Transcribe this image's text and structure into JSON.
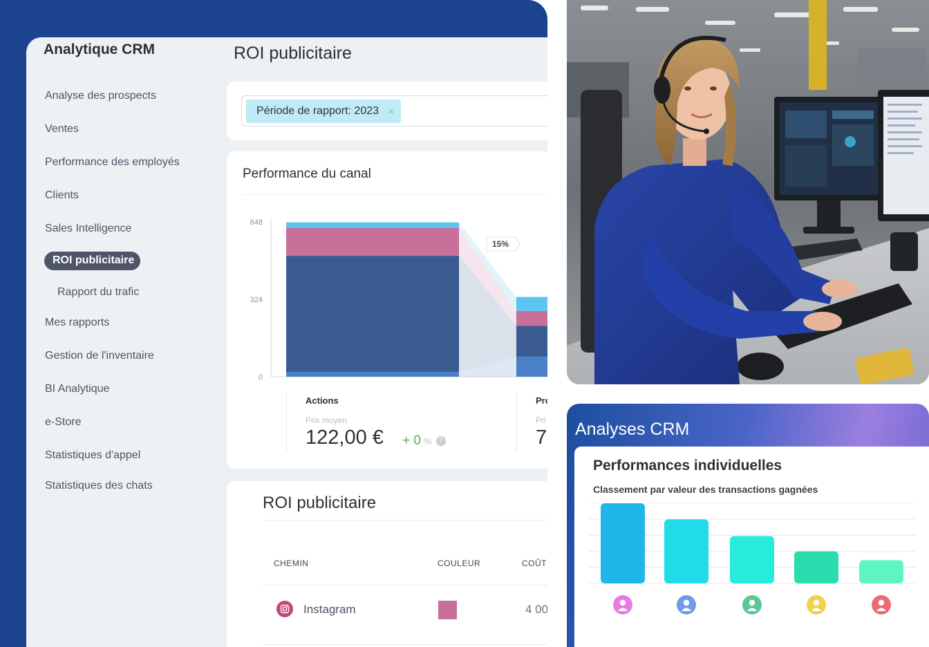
{
  "crm": {
    "app_title": "Analytique CRM",
    "page_title": "ROI publicitaire",
    "sidebar": [
      {
        "label": "Analyse des prospects"
      },
      {
        "label": "Ventes"
      },
      {
        "label": "Performance des employés"
      },
      {
        "label": "Clients"
      },
      {
        "label": "Sales Intelligence"
      },
      {
        "label": "ROI publicitaire",
        "active": true
      },
      {
        "label": "Rapport du trafic",
        "sub": true
      },
      {
        "label": "Mes rapports"
      },
      {
        "label": "Gestion de l'inventaire"
      },
      {
        "label": "BI Analytique"
      },
      {
        "label": "e-Store"
      },
      {
        "label": "Statistiques d'appel"
      },
      {
        "label": "Statistiques des chats"
      }
    ],
    "filter": {
      "chip_label": "Période de rapport: 2023",
      "remove_glyph": "×"
    },
    "channel_card": {
      "title": "Performance du canal",
      "conversion_label": "15%",
      "stats": [
        {
          "name": "Actions",
          "sub": "Prix moyen",
          "value": "122,00 €",
          "delta": "+ 0",
          "delta_unit": "%",
          "help": "?"
        },
        {
          "name": "Pro",
          "sub": "Pri",
          "value": "7"
        }
      ]
    },
    "roi_table": {
      "title": "ROI publicitaire",
      "columns": [
        "CHEMIN",
        "COULEUR",
        "COÛT"
      ],
      "rows": [
        {
          "path": "Instagram",
          "color": "#c86f9a",
          "cost": "4 00"
        }
      ]
    }
  },
  "chart_data": {
    "type": "bar",
    "title": "Performance du canal",
    "yticks": [
      0,
      324,
      648
    ],
    "ylim": [
      0,
      648
    ],
    "categories": [
      "Actions",
      "Pro"
    ],
    "series": [
      {
        "color": "#4a80c8",
        "values": [
          20,
          84
        ]
      },
      {
        "color": "#3a5a92",
        "values": [
          486,
          129
        ]
      },
      {
        "color": "#c86f9a",
        "values": [
          118,
          62
        ]
      },
      {
        "color": "#5bc4ef",
        "values": [
          22,
          59
        ]
      }
    ],
    "annotation": "15%"
  },
  "analytics": {
    "title": "Analyses CRM",
    "panel_title": "Performances individuelles",
    "panel_subtitle": "Classement par valeur des transactions gagnées",
    "ranking_chart": {
      "type": "bar",
      "values": [
        100,
        80,
        59,
        40,
        29
      ],
      "bar_colors": [
        "#21b6ea",
        "#22dbe9",
        "#27ecdc",
        "#2bdcae",
        "#5ff5c3"
      ],
      "avatar_colors": [
        "#e77be6",
        "#6f9ce8",
        "#5bc898",
        "#f2d14a",
        "#ec6b72"
      ]
    }
  },
  "photo": {
    "subject": "Operator wearing a headset typing at a workstation with monitors"
  }
}
